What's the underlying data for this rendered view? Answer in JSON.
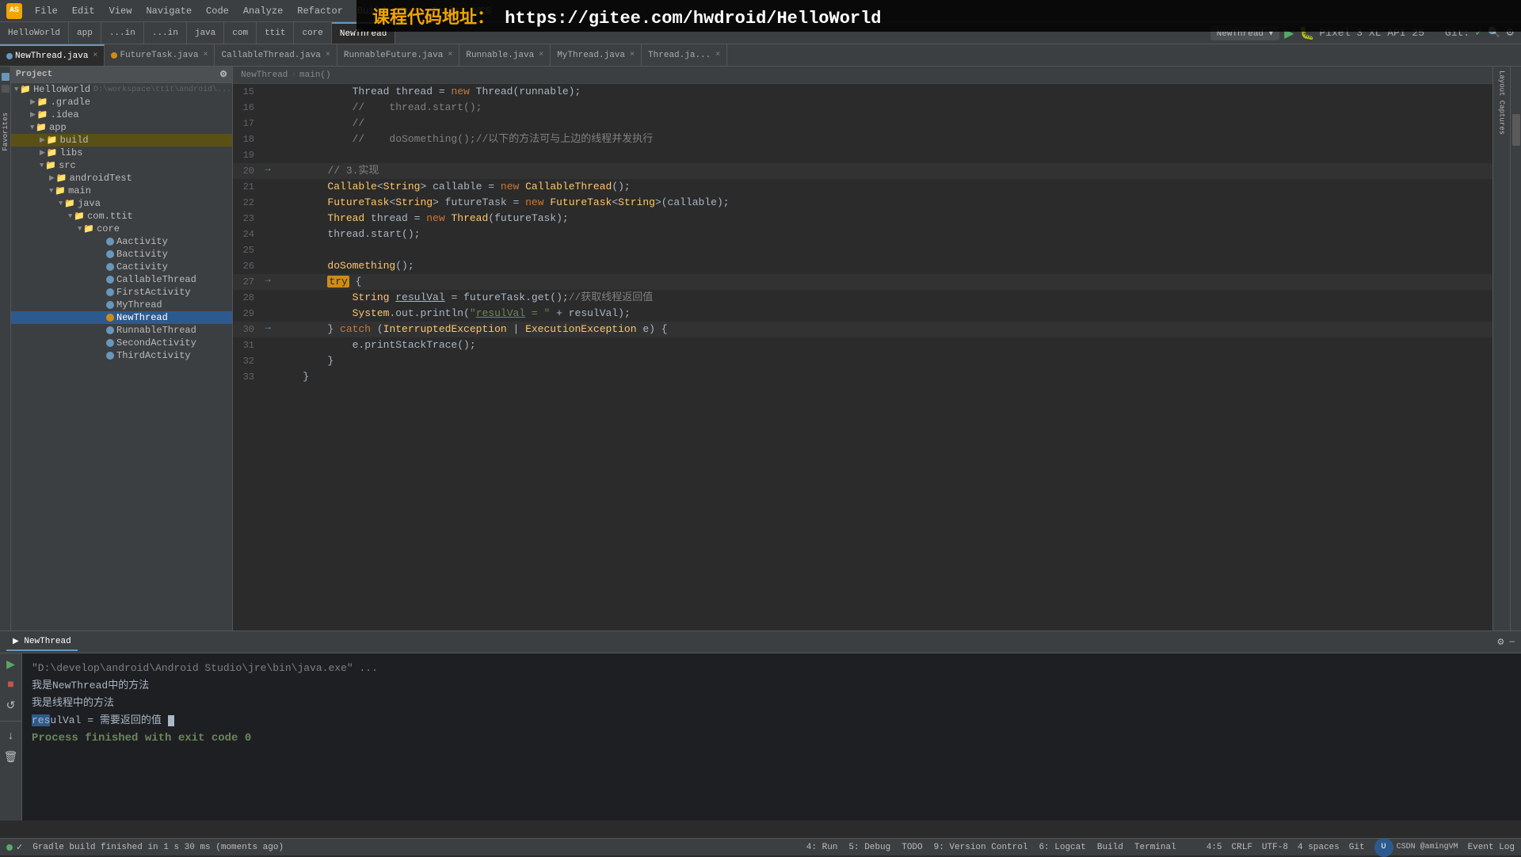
{
  "app": {
    "title": "Android Studio",
    "logo": "AS"
  },
  "course_banner": {
    "prefix": "课程代码地址：",
    "url": "https://gitee.com/hwdroid/HelloWorld"
  },
  "menu": {
    "items": [
      "File",
      "Edit",
      "View",
      "Navigate",
      "Code",
      "Analyze",
      "Refactor",
      "Build",
      "Run",
      "Tools",
      "VCS"
    ]
  },
  "nav_tabs": {
    "items": [
      "HelloWorld",
      "app",
      "...in",
      "...in",
      "java",
      "com",
      "ttit",
      "core",
      "NewThread"
    ]
  },
  "run_config": {
    "label": "NewThread",
    "device": "Pixel 3 XL API 25"
  },
  "file_tabs": [
    {
      "name": "NewThread.java",
      "active": true,
      "modified": false
    },
    {
      "name": "FutureTask.java",
      "active": false
    },
    {
      "name": "CallableThread.java",
      "active": false
    },
    {
      "name": "RunnableFuture.java",
      "active": false
    },
    {
      "name": "Runnable.java",
      "active": false
    },
    {
      "name": "MyThread.java",
      "active": false
    },
    {
      "name": "Thread.ja...",
      "active": false
    }
  ],
  "breadcrumb": {
    "parts": [
      "NewThread",
      "main()"
    ]
  },
  "code": {
    "lines": [
      {
        "num": 15,
        "gutter": "",
        "content": "            Thread thread = new Thread(runnable);",
        "tokens": [
          {
            "text": "            Thread thread = ",
            "cls": "type"
          },
          {
            "text": "new",
            "cls": "kw"
          },
          {
            "text": " Thread(runnable);",
            "cls": "type"
          }
        ]
      },
      {
        "num": 16,
        "gutter": "",
        "content": "            //    thread.start();",
        "comment": true
      },
      {
        "num": 17,
        "gutter": "",
        "content": "            //",
        "comment": true
      },
      {
        "num": 18,
        "gutter": "",
        "content": "            //    doSomething();//以下的方法可与上边的线程并发执行",
        "comment": true
      },
      {
        "num": 19,
        "gutter": "",
        "content": ""
      },
      {
        "num": 20,
        "gutter": "arrow",
        "content": "        // 3.实现"
      },
      {
        "num": 21,
        "gutter": "",
        "content": "        Callable<String> callable = new CallableThread();"
      },
      {
        "num": 22,
        "gutter": "",
        "content": "        FutureTask<String> futureTask = new FutureTask<String>(callable);"
      },
      {
        "num": 23,
        "gutter": "",
        "content": "        Thread thread = new Thread(futureTask);"
      },
      {
        "num": 24,
        "gutter": "",
        "content": "        thread.start();"
      },
      {
        "num": 25,
        "gutter": "",
        "content": ""
      },
      {
        "num": 26,
        "gutter": "",
        "content": "        doSomething();"
      },
      {
        "num": 27,
        "gutter": "arrow",
        "content": "        try {"
      },
      {
        "num": 28,
        "gutter": "",
        "content": "            String resulVal = futureTask.get();//获取线程返回值"
      },
      {
        "num": 29,
        "gutter": "",
        "content": "            System.out.println(\"resulVal = \" + resulVal);"
      },
      {
        "num": 30,
        "gutter": "arrow",
        "content": "        } catch (InterruptedException | ExecutionException e) {"
      },
      {
        "num": 31,
        "gutter": "",
        "content": "            e.printStackTrace();"
      },
      {
        "num": 32,
        "gutter": "",
        "content": "        }"
      },
      {
        "num": 33,
        "gutter": "",
        "content": "    }"
      }
    ]
  },
  "project_tree": {
    "header": "Project",
    "items": [
      {
        "indent": 0,
        "label": "HelloWorld",
        "type": "folder",
        "expanded": true,
        "path": "D:\\workspace\\ttit\\android\\..."
      },
      {
        "indent": 1,
        "label": ".gradle",
        "type": "folder",
        "expanded": false
      },
      {
        "indent": 1,
        "label": ".idea",
        "type": "folder",
        "expanded": false
      },
      {
        "indent": 1,
        "label": "app",
        "type": "folder",
        "expanded": true
      },
      {
        "indent": 2,
        "label": "build",
        "type": "folder",
        "expanded": false,
        "highlight": true
      },
      {
        "indent": 2,
        "label": "libs",
        "type": "folder",
        "expanded": false
      },
      {
        "indent": 2,
        "label": "src",
        "type": "folder",
        "expanded": true
      },
      {
        "indent": 3,
        "label": "androidTest",
        "type": "folder",
        "expanded": false
      },
      {
        "indent": 3,
        "label": "main",
        "type": "folder",
        "expanded": true
      },
      {
        "indent": 4,
        "label": "java",
        "type": "folder",
        "expanded": true
      },
      {
        "indent": 5,
        "label": "com.ttit",
        "type": "folder",
        "expanded": true
      },
      {
        "indent": 6,
        "label": "core",
        "type": "folder",
        "expanded": true
      },
      {
        "indent": 7,
        "label": "Aactivity",
        "type": "java"
      },
      {
        "indent": 7,
        "label": "Bactivity",
        "type": "java"
      },
      {
        "indent": 7,
        "label": "Cactivity",
        "type": "java"
      },
      {
        "indent": 7,
        "label": "CallableThread",
        "type": "java"
      },
      {
        "indent": 7,
        "label": "FirstActivity",
        "type": "java"
      },
      {
        "indent": 7,
        "label": "MyThread",
        "type": "java"
      },
      {
        "indent": 7,
        "label": "NewThread",
        "type": "java",
        "selected": true
      },
      {
        "indent": 7,
        "label": "RunnableThread",
        "type": "java"
      },
      {
        "indent": 7,
        "label": "SecondActivity",
        "type": "java"
      },
      {
        "indent": 7,
        "label": "ThirdActivity",
        "type": "java"
      }
    ]
  },
  "run_panel": {
    "tab_label": "NewThread",
    "command": "\"D:\\develop\\android\\Android Studio\\jre\\bin\\java.exe\" ...",
    "output_lines": [
      "我是NewThread中的方法",
      "我是线程中的方法",
      "resulVal = 需要返回的值",
      "",
      "Process finished with exit code 0"
    ],
    "cursor_line": "resulVal = 需要返回的值",
    "cursor_pos": "res"
  },
  "status_bar": {
    "run_label": "4: Run",
    "debug_label": "5: Debug",
    "todo_label": "TODO",
    "version_label": "9: Version Control",
    "logcat_label": "6: Logcat",
    "build_label": "Build",
    "terminal_label": "Terminal",
    "position": "4:5",
    "line_sep": "CRLF",
    "encoding": "UTF-8",
    "indent": "4 spaces",
    "branch": "Git",
    "gradle_status": "Gradle build finished in 1 s 30 ms (moments ago)"
  }
}
